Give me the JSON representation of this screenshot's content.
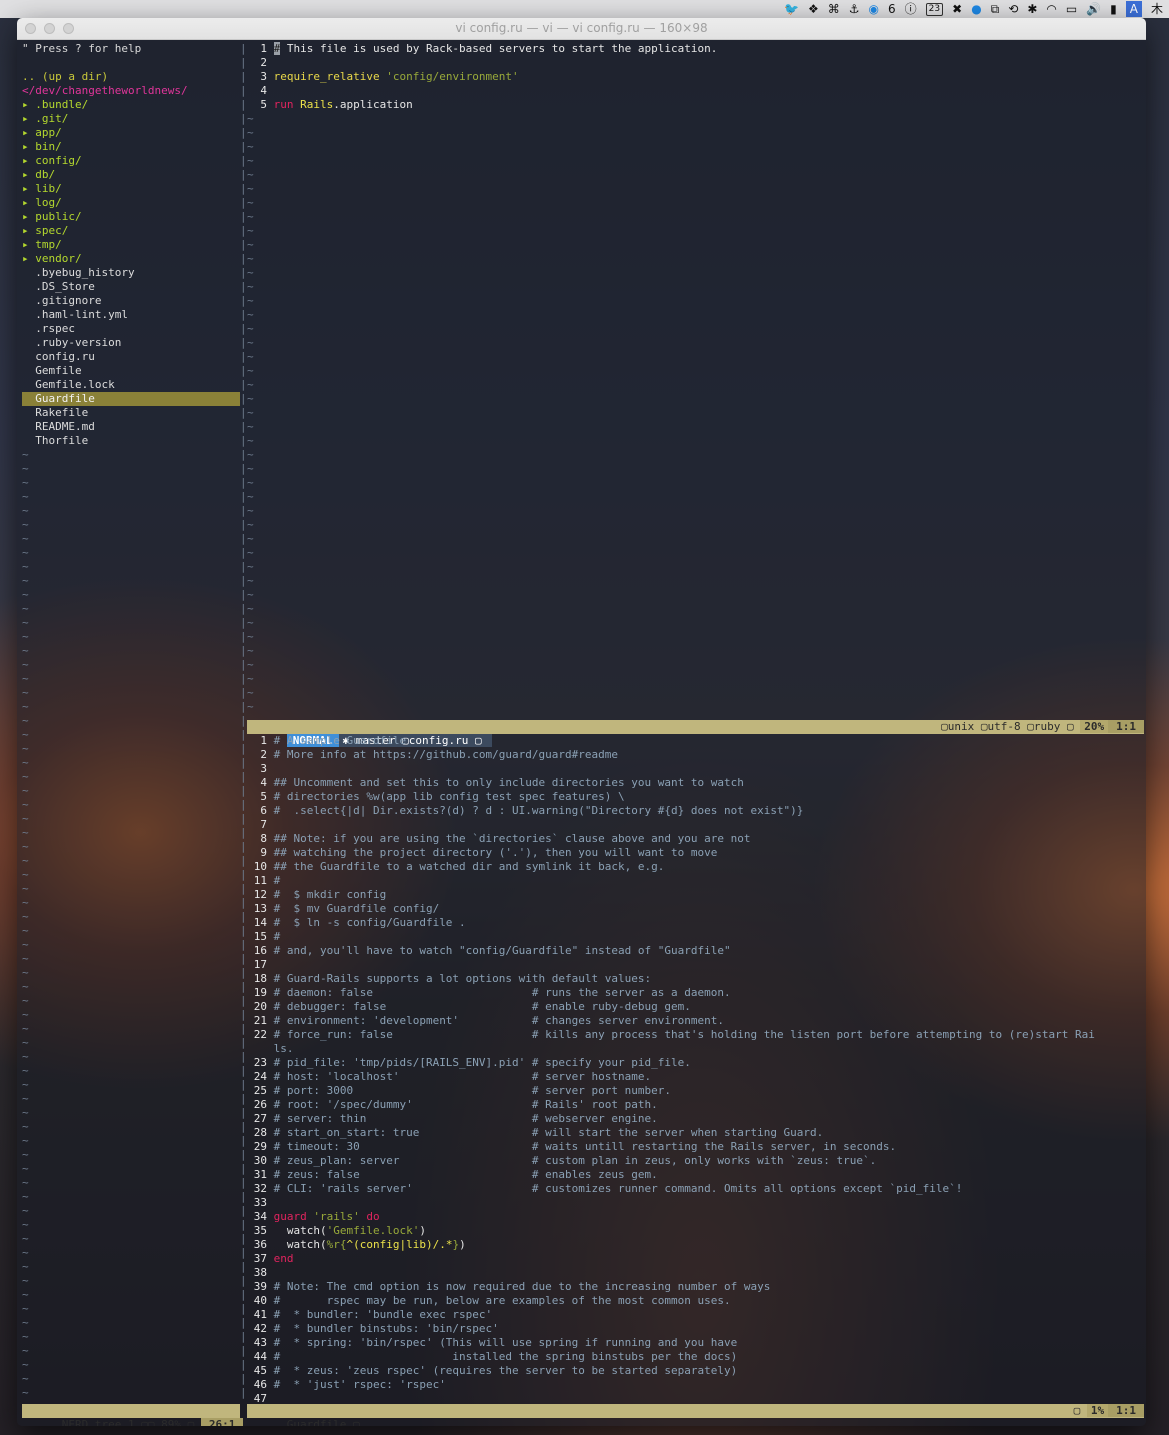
{
  "menubar": {
    "icons": [
      "twitter-icon",
      "dropbox-icon",
      "command-icon",
      "docker-icon",
      "antivirus-icon",
      "onepassword-icon",
      "calendar-icon",
      "x-icon",
      "circle-icon",
      "crop-icon",
      "time-machine-icon",
      "bluetooth-icon",
      "wifi-icon",
      "airplay-icon",
      "volume-icon",
      "battery-icon",
      "input-source-icon"
    ],
    "badge_count": "6",
    "calendar_day": "23",
    "input_source": "A",
    "clock_partial": "木"
  },
  "window": {
    "title": "vi config.ru — vi — vi config.ru — 160×98"
  },
  "nerdtree": {
    "help": "\" Press ? for help",
    "up": ".. (up a dir)",
    "root": "</dev/changetheworldnews/",
    "dirs": [
      ".bundle/",
      ".git/",
      "app/",
      "bin/",
      "config/",
      "db/",
      "lib/",
      "log/",
      "public/",
      "spec/",
      "tmp/",
      "vendor/"
    ],
    "files": [
      ".byebug_history",
      ".DS_Store",
      ".gitignore",
      ".haml-lint.yml",
      ".rspec",
      ".ruby-version",
      "config.ru",
      "Gemfile",
      "Gemfile.lock",
      "Guardfile",
      "Rakefile",
      "README.md",
      "Thorfile"
    ],
    "selected": "Guardfile",
    "status": {
      "name": "NERD_tree_1",
      "percent": "89%",
      "pos": "26:1"
    }
  },
  "top_editor": {
    "lines": [
      {
        "n": "1",
        "code": "# This file is used by Rack-based servers to start the application."
      },
      {
        "n": "2",
        "code": ""
      },
      {
        "n": "3",
        "code": "require_relative 'config/environment'"
      },
      {
        "n": "4",
        "code": ""
      },
      {
        "n": "5",
        "code": "run Rails.application"
      }
    ],
    "status": {
      "mode": "NORMAL",
      "branch": "✱ master",
      "file": "config.ru",
      "format": "unix",
      "encoding": "utf-8",
      "filetype": "ruby",
      "percent": "20%",
      "pos": "1:1"
    }
  },
  "bottom_editor": {
    "lines": [
      {
        "n": "1",
        "code": "# A sample Guardfile"
      },
      {
        "n": "2",
        "code": "# More info at https://github.com/guard/guard#readme"
      },
      {
        "n": "3",
        "code": ""
      },
      {
        "n": "4",
        "code": "## Uncomment and set this to only include directories you want to watch"
      },
      {
        "n": "5",
        "code": "# directories %w(app lib config test spec features) \\"
      },
      {
        "n": "6",
        "code": "#  .select{|d| Dir.exists?(d) ? d : UI.warning(\"Directory #{d} does not exist\")}"
      },
      {
        "n": "7",
        "code": ""
      },
      {
        "n": "8",
        "code": "## Note: if you are using the `directories` clause above and you are not"
      },
      {
        "n": "9",
        "code": "## watching the project directory ('.'), then you will want to move"
      },
      {
        "n": "10",
        "code": "## the Guardfile to a watched dir and symlink it back, e.g."
      },
      {
        "n": "11",
        "code": "#"
      },
      {
        "n": "12",
        "code": "#  $ mkdir config"
      },
      {
        "n": "13",
        "code": "#  $ mv Guardfile config/"
      },
      {
        "n": "14",
        "code": "#  $ ln -s config/Guardfile ."
      },
      {
        "n": "15",
        "code": "#"
      },
      {
        "n": "16",
        "code": "# and, you'll have to watch \"config/Guardfile\" instead of \"Guardfile\""
      },
      {
        "n": "17",
        "code": ""
      },
      {
        "n": "18",
        "code": "# Guard-Rails supports a lot options with default values:"
      },
      {
        "n": "19",
        "code": "# daemon: false                        # runs the server as a daemon."
      },
      {
        "n": "20",
        "code": "# debugger: false                      # enable ruby-debug gem."
      },
      {
        "n": "21",
        "code": "# environment: 'development'           # changes server environment."
      },
      {
        "n": "22",
        "code": "# force_run: false                     # kills any process that's holding the listen port before attempting to (re)start Rai"
      },
      {
        "n": "",
        "code": "ls."
      },
      {
        "n": "23",
        "code": "# pid_file: 'tmp/pids/[RAILS_ENV].pid' # specify your pid_file."
      },
      {
        "n": "24",
        "code": "# host: 'localhost'                    # server hostname."
      },
      {
        "n": "25",
        "code": "# port: 3000                           # server port number."
      },
      {
        "n": "26",
        "code": "# root: '/spec/dummy'                  # Rails' root path."
      },
      {
        "n": "27",
        "code": "# server: thin                         # webserver engine."
      },
      {
        "n": "28",
        "code": "# start_on_start: true                 # will start the server when starting Guard."
      },
      {
        "n": "29",
        "code": "# timeout: 30                          # waits untill restarting the Rails server, in seconds."
      },
      {
        "n": "30",
        "code": "# zeus_plan: server                    # custom plan in zeus, only works with `zeus: true`."
      },
      {
        "n": "31",
        "code": "# zeus: false                          # enables zeus gem."
      },
      {
        "n": "32",
        "code": "# CLI: 'rails server'                  # customizes runner command. Omits all options except `pid_file`!"
      },
      {
        "n": "33",
        "code": ""
      },
      {
        "n": "34",
        "code": "guard 'rails' do"
      },
      {
        "n": "35",
        "code": "  watch('Gemfile.lock')"
      },
      {
        "n": "36",
        "code": "  watch(%r{^(config|lib)/.*})"
      },
      {
        "n": "37",
        "code": "end"
      },
      {
        "n": "38",
        "code": ""
      },
      {
        "n": "39",
        "code": "# Note: The cmd option is now required due to the increasing number of ways"
      },
      {
        "n": "40",
        "code": "#       rspec may be run, below are examples of the most common uses."
      },
      {
        "n": "41",
        "code": "#  * bundler: 'bundle exec rspec'"
      },
      {
        "n": "42",
        "code": "#  * bundler binstubs: 'bin/rspec'"
      },
      {
        "n": "43",
        "code": "#  * spring: 'bin/rspec' (This will use spring if running and you have"
      },
      {
        "n": "44",
        "code": "#                          installed the spring binstubs per the docs)"
      },
      {
        "n": "45",
        "code": "#  * zeus: 'zeus rspec' (requires the server to be started separately)"
      },
      {
        "n": "46",
        "code": "#  * 'just' rspec: 'rspec'"
      },
      {
        "n": "47",
        "code": ""
      }
    ],
    "status": {
      "file": "Guardfile",
      "percent": "1%",
      "pos": "1:1"
    }
  },
  "tilde": "~",
  "separator": "|"
}
